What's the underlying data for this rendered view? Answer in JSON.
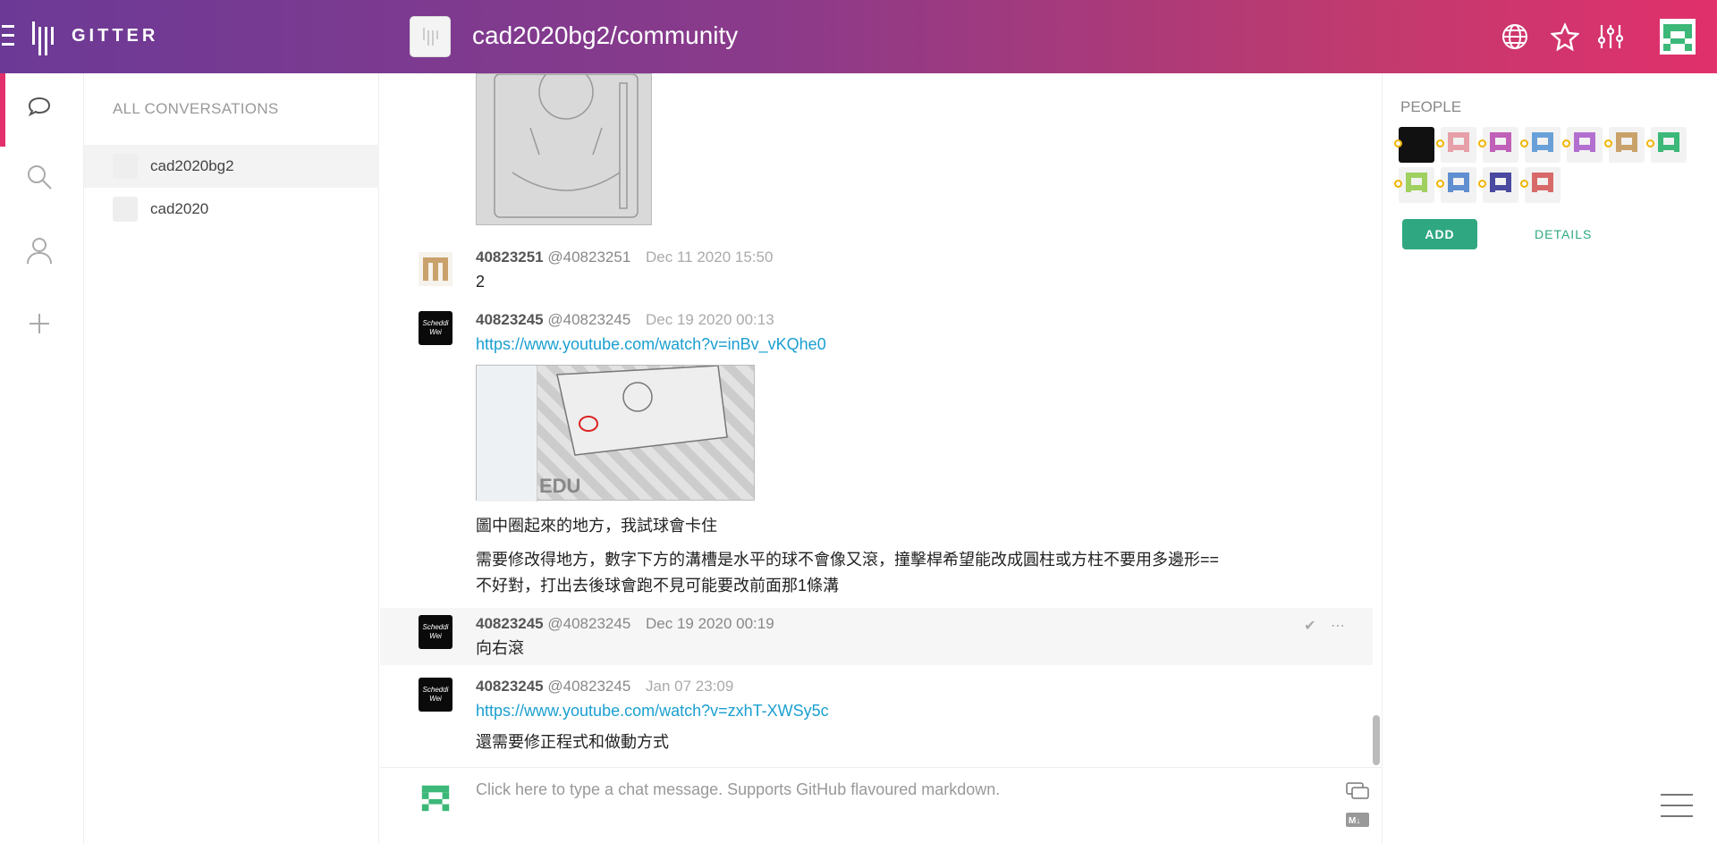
{
  "header": {
    "brand": "GITTER",
    "room_title": "cad2020bg2/community",
    "colors": {
      "gradient_start": "#6c3a96",
      "gradient_end": "#e1306c"
    },
    "icons": [
      "globe-icon",
      "star-icon",
      "settings-sliders-icon",
      "user-avatar"
    ]
  },
  "rail": {
    "icons": [
      "chat-bubble-icon",
      "search-icon",
      "person-icon",
      "plus-icon"
    ]
  },
  "conversations": {
    "title": "ALL CONVERSATIONS",
    "items": [
      {
        "label": "cad2020bg2",
        "active": true
      },
      {
        "label": "cad2020",
        "active": false
      }
    ]
  },
  "messages": [
    {
      "user": "40823251",
      "handle": "@40823251",
      "time": "Dec 11 2020 15:50",
      "text": "2"
    },
    {
      "user": "40823245",
      "handle": "@40823245",
      "time": "Dec 19 2020 00:13",
      "link": "https://www.youtube.com/watch?v=inBv_vKQhe0",
      "thumb_label": "EDU",
      "avatar_text": "Scheddi Wei",
      "lines": [
        "圖中圈起來的地方，我試球會卡住",
        "需要修改得地方，數字下方的溝槽是水平的球不會像又滾，撞擊桿希望能改成圓柱或方柱不要用多邊形==",
        "不好對，打出去後球會跑不見可能要改前面那1條溝"
      ]
    },
    {
      "user": "40823245",
      "handle": "@40823245",
      "time": "Dec 19 2020 00:19",
      "text": "向右滾"
    },
    {
      "user": "40823245",
      "handle": "@40823245",
      "time": "Jan 07 23:09",
      "link": "https://www.youtube.com/watch?v=zxhT-XWSy5c",
      "text": "還需要修正程式和做動方式"
    }
  ],
  "input": {
    "placeholder": "Click here to type a chat message. Supports GitHub flavoured markdown."
  },
  "people": {
    "title": "PEOPLE",
    "add_label": "ADD",
    "details_label": "DETAILS",
    "count": 12
  }
}
